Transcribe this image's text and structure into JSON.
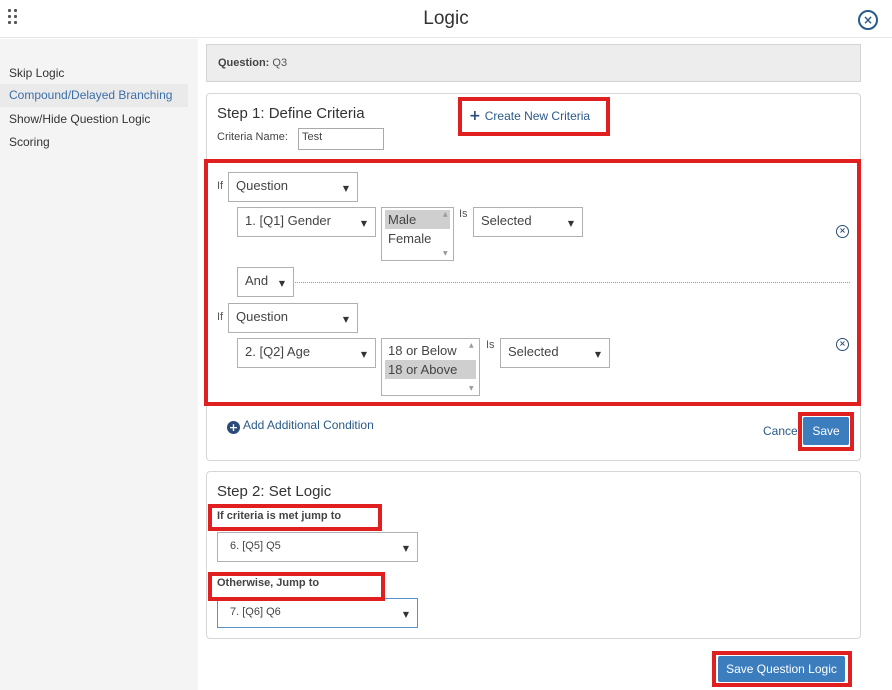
{
  "window": {
    "title": "Logic",
    "close_glyph": "×"
  },
  "sidebar": {
    "items": [
      {
        "label": "Skip Logic",
        "active": false
      },
      {
        "label": "Compound/Delayed Branching",
        "active": true
      },
      {
        "label": "Show/Hide Question Logic",
        "active": false
      },
      {
        "label": "Scoring",
        "active": false
      }
    ]
  },
  "question_bar": {
    "label": "Question:",
    "value": "Q3"
  },
  "step1": {
    "title": "Step 1: Define Criteria",
    "create_new_criteria": "Create New Criteria",
    "criteria_name_label": "Criteria Name:",
    "criteria_name_value": "Test",
    "conditions": [
      {
        "if_label": "If",
        "type_select": "Question",
        "question_select": "1. [Q1] Gender",
        "options": [
          {
            "label": "Male",
            "selected": true
          },
          {
            "label": "Female",
            "selected": false
          }
        ],
        "is_label": "Is",
        "operator_select": "Selected"
      },
      {
        "if_label": "If",
        "type_select": "Question",
        "question_select": "2. [Q2] Age",
        "options": [
          {
            "label": "18 or Below",
            "selected": false
          },
          {
            "label": "18 or Above",
            "selected": true
          }
        ],
        "is_label": "Is",
        "operator_select": "Selected"
      }
    ],
    "connector_select": "And",
    "add_condition": "Add Additional Condition",
    "cancel": "Cancel",
    "save": "Save"
  },
  "step2": {
    "title": "Step 2: Set Logic",
    "met_label": "If criteria is met jump to",
    "met_select": "6. [Q5] Q5",
    "otherwise_label": "Otherwise, Jump to",
    "otherwise_select": "7. [Q6] Q6"
  },
  "save_question_logic": "Save Question Logic",
  "colors": {
    "accent": "#3b7dbd",
    "link": "#2a5a8a",
    "highlight": "#e02020",
    "sidebar_bg": "#f4f4f4"
  },
  "icons": {
    "drag": "drag-handle-icon",
    "close": "close-circle-icon",
    "remove": "remove-circle-icon",
    "add": "plus-circle-icon",
    "create": "plus-icon",
    "dropdown": "chevron-down-icon"
  }
}
